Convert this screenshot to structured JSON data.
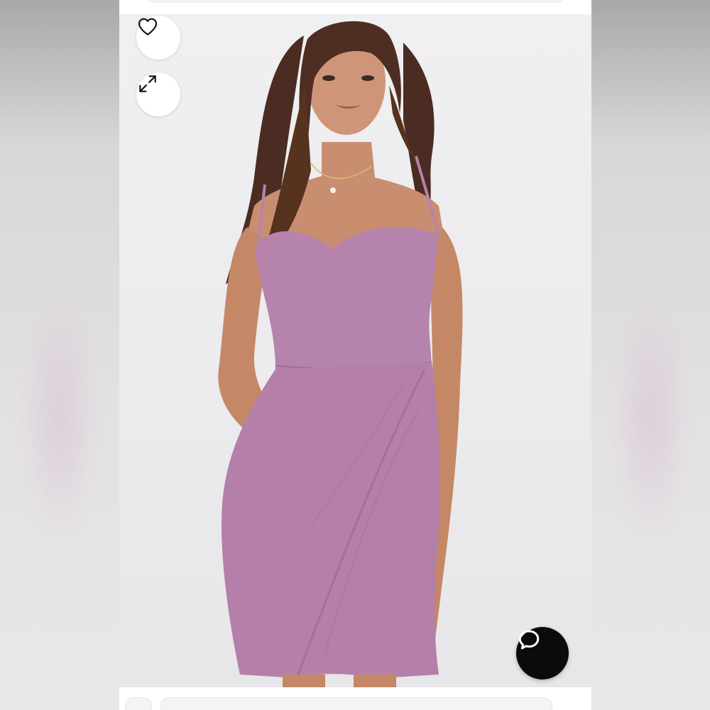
{
  "product_image": {
    "description_label": "",
    "dress_color": "#b683ac"
  },
  "actions": {
    "favorite_icon": "heart-icon",
    "expand_icon": "expand-arrows-icon",
    "chat_icon": "chat-bubble-icon"
  },
  "colors": {
    "chat_button_bg": "#0b0b0c",
    "button_bg": "#ffffff",
    "icon_stroke": "#111111"
  }
}
